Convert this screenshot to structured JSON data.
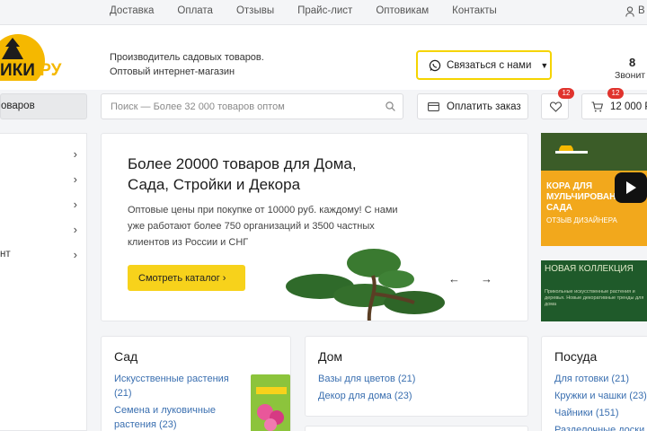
{
  "topnav": [
    "Доставка",
    "Оплата",
    "Отзывы",
    "Прайс-лист",
    "Оптовикам",
    "Контакты"
  ],
  "top_login": "В",
  "logo": {
    "text_main": "ИКИ",
    "text_ru": ".РУ"
  },
  "tagline": {
    "line1": "Производитель садовых товаров.",
    "line2": "Оптовый интернет-магазин"
  },
  "whatsapp": {
    "label": "Связаться с нами"
  },
  "phone_cut": "8 ",
  "call_cut": "Звонит",
  "catalog_button": "оваров",
  "search": {
    "placeholder": "Поиск — Более 32 000 товаров оптом"
  },
  "pay_button": "Оплатить заказ",
  "favorites": {
    "badge": "12"
  },
  "cart": {
    "badge": "12",
    "total": "12 000 Р"
  },
  "sidebar_tail": [
    "",
    "",
    "",
    "",
    "нт"
  ],
  "hero": {
    "title": "Более 20000 товаров для Дома, Сада, Стройки и Декора",
    "text": "Оптовые цены при покупке от 10000 руб. каждому! С нами уже работают более 750 организаций и 3500 частных клиентов из России и СНГ",
    "button": "Смотреть каталог"
  },
  "promo1": {
    "title": "КОРА ДЛЯ МУЛЬЧИРОВАН САДА",
    "sub": "ОТЗЫВ ДИЗАЙНЕРА"
  },
  "promo2": {
    "title": "НОВАЯ КОЛЛЕКЦИЯ",
    "text": "Прикольные искусственные растения и деревья. Новые декоративные тренды для дома"
  },
  "cards": {
    "sad": {
      "title": "Сад",
      "links": [
        "Искусственные растения",
        "(21)",
        "Семена и луковичные",
        "растения (23)"
      ]
    },
    "dom": {
      "title": "Дом",
      "links": [
        "Вазы для цветов (21)",
        "Декор для дома (23)"
      ]
    },
    "posuda": {
      "title": "Посуда",
      "links": [
        "Для готовки (21)",
        "Кружки и чашки (23)",
        "Чайники (151)",
        "Разделочные доски"
      ]
    }
  },
  "colors": {
    "accent": "#f7d21b",
    "link": "#3a6fb0",
    "badge": "#e0332d"
  }
}
